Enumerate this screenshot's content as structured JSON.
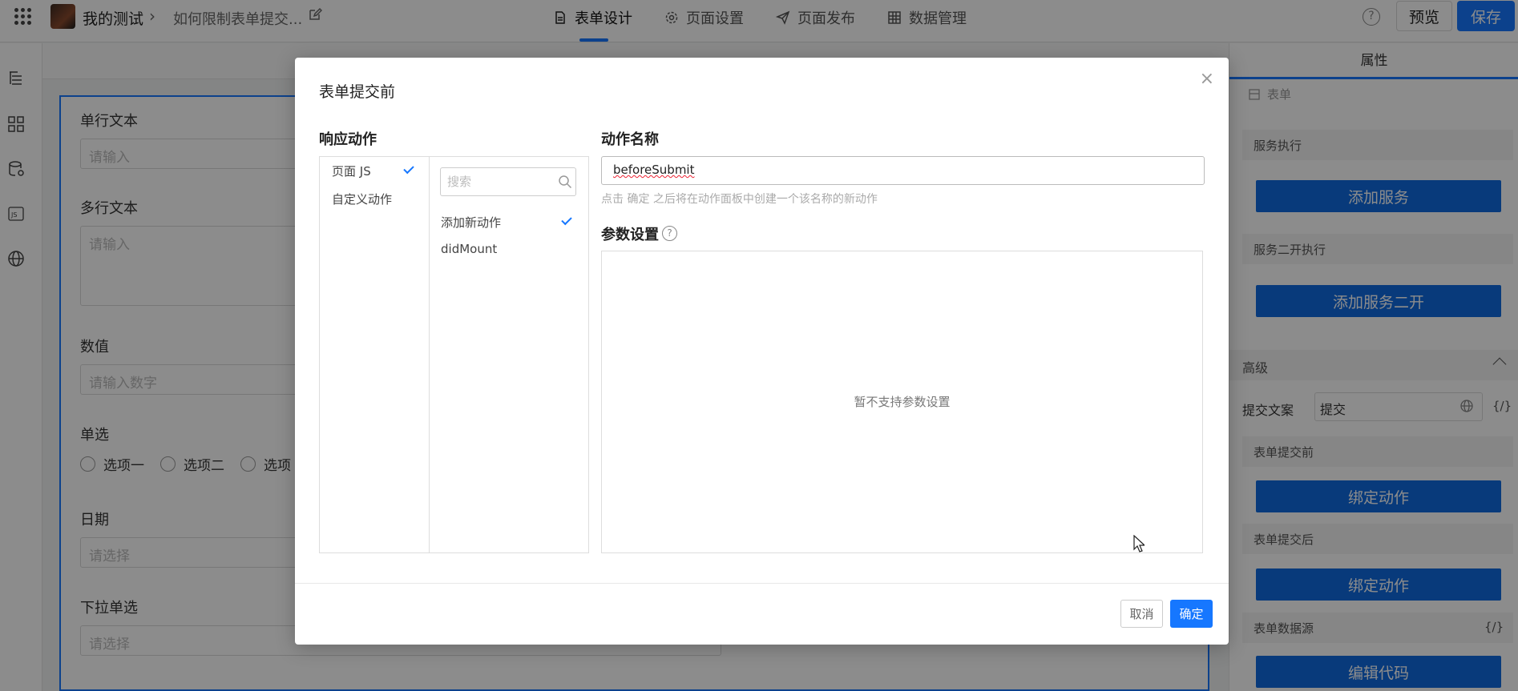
{
  "topbar": {
    "app_name": "我的测试",
    "page_name": "如何限制表单提交...",
    "tabs": [
      {
        "label": "表单设计",
        "active": true,
        "icon": "document-icon"
      },
      {
        "label": "页面设置",
        "active": false,
        "icon": "gear-icon"
      },
      {
        "label": "页面发布",
        "active": false,
        "icon": "send-icon"
      },
      {
        "label": "数据管理",
        "active": false,
        "icon": "table-icon"
      }
    ],
    "preview_label": "预览",
    "save_label": "保存",
    "accent": "#1677ff"
  },
  "canvas": {
    "fields": [
      {
        "label": "单行文本",
        "placeholder": "请输入"
      },
      {
        "label": "多行文本",
        "placeholder": "请输入"
      },
      {
        "label": "数值",
        "placeholder": "请输入数字"
      },
      {
        "label": "单选",
        "options": [
          "选项一",
          "选项二",
          "选项"
        ]
      },
      {
        "label": "日期",
        "placeholder": "请选择"
      },
      {
        "label": "下拉单选",
        "placeholder": "请选择"
      }
    ]
  },
  "right_panel": {
    "title": "属性",
    "crumb": "表单",
    "service_exec": "服务执行",
    "add_service": "添加服务",
    "service_ext_exec": "服务二开执行",
    "add_service_ext": "添加服务二开",
    "advanced": "高级",
    "submit_text_label": "提交文案",
    "submit_text_value": "提交",
    "fx": "{/}",
    "before_submit": "表单提交前",
    "bind_action_1": "绑定动作",
    "after_submit": "表单提交后",
    "bind_action_2": "绑定动作",
    "datasource": "表单数据源",
    "edit_code": "编辑代码"
  },
  "modal": {
    "title": "表单提交前",
    "response_action_heading": "响应动作",
    "categories": [
      {
        "label": "页面 JS",
        "selected": true
      },
      {
        "label": "自定义动作",
        "selected": false
      }
    ],
    "search_placeholder": "搜索",
    "actions": [
      {
        "label": "添加新动作",
        "selected": true
      },
      {
        "label": "didMount",
        "selected": false
      }
    ],
    "action_name_heading": "动作名称",
    "action_name_value": "beforeSubmit",
    "action_name_hint": "点击 确定 之后将在动作面板中创建一个该名称的新动作",
    "params_heading": "参数设置",
    "params_empty": "暂不支持参数设置",
    "cancel_label": "取消",
    "ok_label": "确定"
  }
}
